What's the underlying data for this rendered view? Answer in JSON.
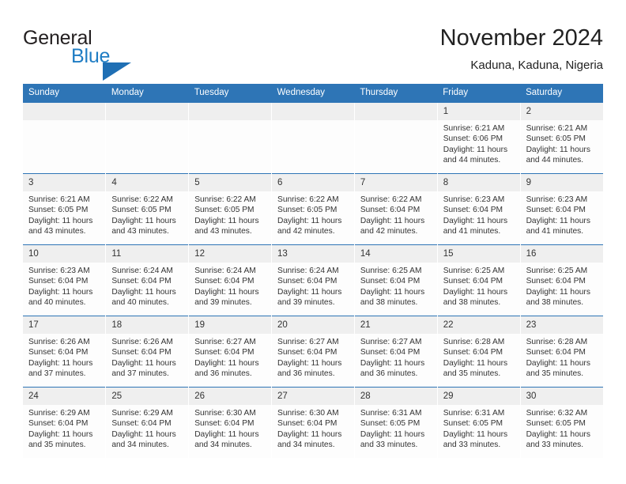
{
  "brand": {
    "name_part1": "General",
    "name_part2": "Blue",
    "triangle_color": "#1f6fb4",
    "blue_color": "#1f7dc4"
  },
  "header": {
    "title": "November 2024",
    "subtitle": "Kaduna, Kaduna, Nigeria",
    "header_bg": "#2e75b6"
  },
  "weekdays": [
    "Sunday",
    "Monday",
    "Tuesday",
    "Wednesday",
    "Thursday",
    "Friday",
    "Saturday"
  ],
  "weeks": [
    [
      {
        "day": "",
        "lines": []
      },
      {
        "day": "",
        "lines": []
      },
      {
        "day": "",
        "lines": []
      },
      {
        "day": "",
        "lines": []
      },
      {
        "day": "",
        "lines": []
      },
      {
        "day": "1",
        "lines": [
          "Sunrise: 6:21 AM",
          "Sunset: 6:06 PM",
          "Daylight: 11 hours and 44 minutes."
        ]
      },
      {
        "day": "2",
        "lines": [
          "Sunrise: 6:21 AM",
          "Sunset: 6:05 PM",
          "Daylight: 11 hours and 44 minutes."
        ]
      }
    ],
    [
      {
        "day": "3",
        "lines": [
          "Sunrise: 6:21 AM",
          "Sunset: 6:05 PM",
          "Daylight: 11 hours and 43 minutes."
        ]
      },
      {
        "day": "4",
        "lines": [
          "Sunrise: 6:22 AM",
          "Sunset: 6:05 PM",
          "Daylight: 11 hours and 43 minutes."
        ]
      },
      {
        "day": "5",
        "lines": [
          "Sunrise: 6:22 AM",
          "Sunset: 6:05 PM",
          "Daylight: 11 hours and 43 minutes."
        ]
      },
      {
        "day": "6",
        "lines": [
          "Sunrise: 6:22 AM",
          "Sunset: 6:05 PM",
          "Daylight: 11 hours and 42 minutes."
        ]
      },
      {
        "day": "7",
        "lines": [
          "Sunrise: 6:22 AM",
          "Sunset: 6:04 PM",
          "Daylight: 11 hours and 42 minutes."
        ]
      },
      {
        "day": "8",
        "lines": [
          "Sunrise: 6:23 AM",
          "Sunset: 6:04 PM",
          "Daylight: 11 hours and 41 minutes."
        ]
      },
      {
        "day": "9",
        "lines": [
          "Sunrise: 6:23 AM",
          "Sunset: 6:04 PM",
          "Daylight: 11 hours and 41 minutes."
        ]
      }
    ],
    [
      {
        "day": "10",
        "lines": [
          "Sunrise: 6:23 AM",
          "Sunset: 6:04 PM",
          "Daylight: 11 hours and 40 minutes."
        ]
      },
      {
        "day": "11",
        "lines": [
          "Sunrise: 6:24 AM",
          "Sunset: 6:04 PM",
          "Daylight: 11 hours and 40 minutes."
        ]
      },
      {
        "day": "12",
        "lines": [
          "Sunrise: 6:24 AM",
          "Sunset: 6:04 PM",
          "Daylight: 11 hours and 39 minutes."
        ]
      },
      {
        "day": "13",
        "lines": [
          "Sunrise: 6:24 AM",
          "Sunset: 6:04 PM",
          "Daylight: 11 hours and 39 minutes."
        ]
      },
      {
        "day": "14",
        "lines": [
          "Sunrise: 6:25 AM",
          "Sunset: 6:04 PM",
          "Daylight: 11 hours and 38 minutes."
        ]
      },
      {
        "day": "15",
        "lines": [
          "Sunrise: 6:25 AM",
          "Sunset: 6:04 PM",
          "Daylight: 11 hours and 38 minutes."
        ]
      },
      {
        "day": "16",
        "lines": [
          "Sunrise: 6:25 AM",
          "Sunset: 6:04 PM",
          "Daylight: 11 hours and 38 minutes."
        ]
      }
    ],
    [
      {
        "day": "17",
        "lines": [
          "Sunrise: 6:26 AM",
          "Sunset: 6:04 PM",
          "Daylight: 11 hours and 37 minutes."
        ]
      },
      {
        "day": "18",
        "lines": [
          "Sunrise: 6:26 AM",
          "Sunset: 6:04 PM",
          "Daylight: 11 hours and 37 minutes."
        ]
      },
      {
        "day": "19",
        "lines": [
          "Sunrise: 6:27 AM",
          "Sunset: 6:04 PM",
          "Daylight: 11 hours and 36 minutes."
        ]
      },
      {
        "day": "20",
        "lines": [
          "Sunrise: 6:27 AM",
          "Sunset: 6:04 PM",
          "Daylight: 11 hours and 36 minutes."
        ]
      },
      {
        "day": "21",
        "lines": [
          "Sunrise: 6:27 AM",
          "Sunset: 6:04 PM",
          "Daylight: 11 hours and 36 minutes."
        ]
      },
      {
        "day": "22",
        "lines": [
          "Sunrise: 6:28 AM",
          "Sunset: 6:04 PM",
          "Daylight: 11 hours and 35 minutes."
        ]
      },
      {
        "day": "23",
        "lines": [
          "Sunrise: 6:28 AM",
          "Sunset: 6:04 PM",
          "Daylight: 11 hours and 35 minutes."
        ]
      }
    ],
    [
      {
        "day": "24",
        "lines": [
          "Sunrise: 6:29 AM",
          "Sunset: 6:04 PM",
          "Daylight: 11 hours and 35 minutes."
        ]
      },
      {
        "day": "25",
        "lines": [
          "Sunrise: 6:29 AM",
          "Sunset: 6:04 PM",
          "Daylight: 11 hours and 34 minutes."
        ]
      },
      {
        "day": "26",
        "lines": [
          "Sunrise: 6:30 AM",
          "Sunset: 6:04 PM",
          "Daylight: 11 hours and 34 minutes."
        ]
      },
      {
        "day": "27",
        "lines": [
          "Sunrise: 6:30 AM",
          "Sunset: 6:04 PM",
          "Daylight: 11 hours and 34 minutes."
        ]
      },
      {
        "day": "28",
        "lines": [
          "Sunrise: 6:31 AM",
          "Sunset: 6:05 PM",
          "Daylight: 11 hours and 33 minutes."
        ]
      },
      {
        "day": "29",
        "lines": [
          "Sunrise: 6:31 AM",
          "Sunset: 6:05 PM",
          "Daylight: 11 hours and 33 minutes."
        ]
      },
      {
        "day": "30",
        "lines": [
          "Sunrise: 6:32 AM",
          "Sunset: 6:05 PM",
          "Daylight: 11 hours and 33 minutes."
        ]
      }
    ]
  ]
}
